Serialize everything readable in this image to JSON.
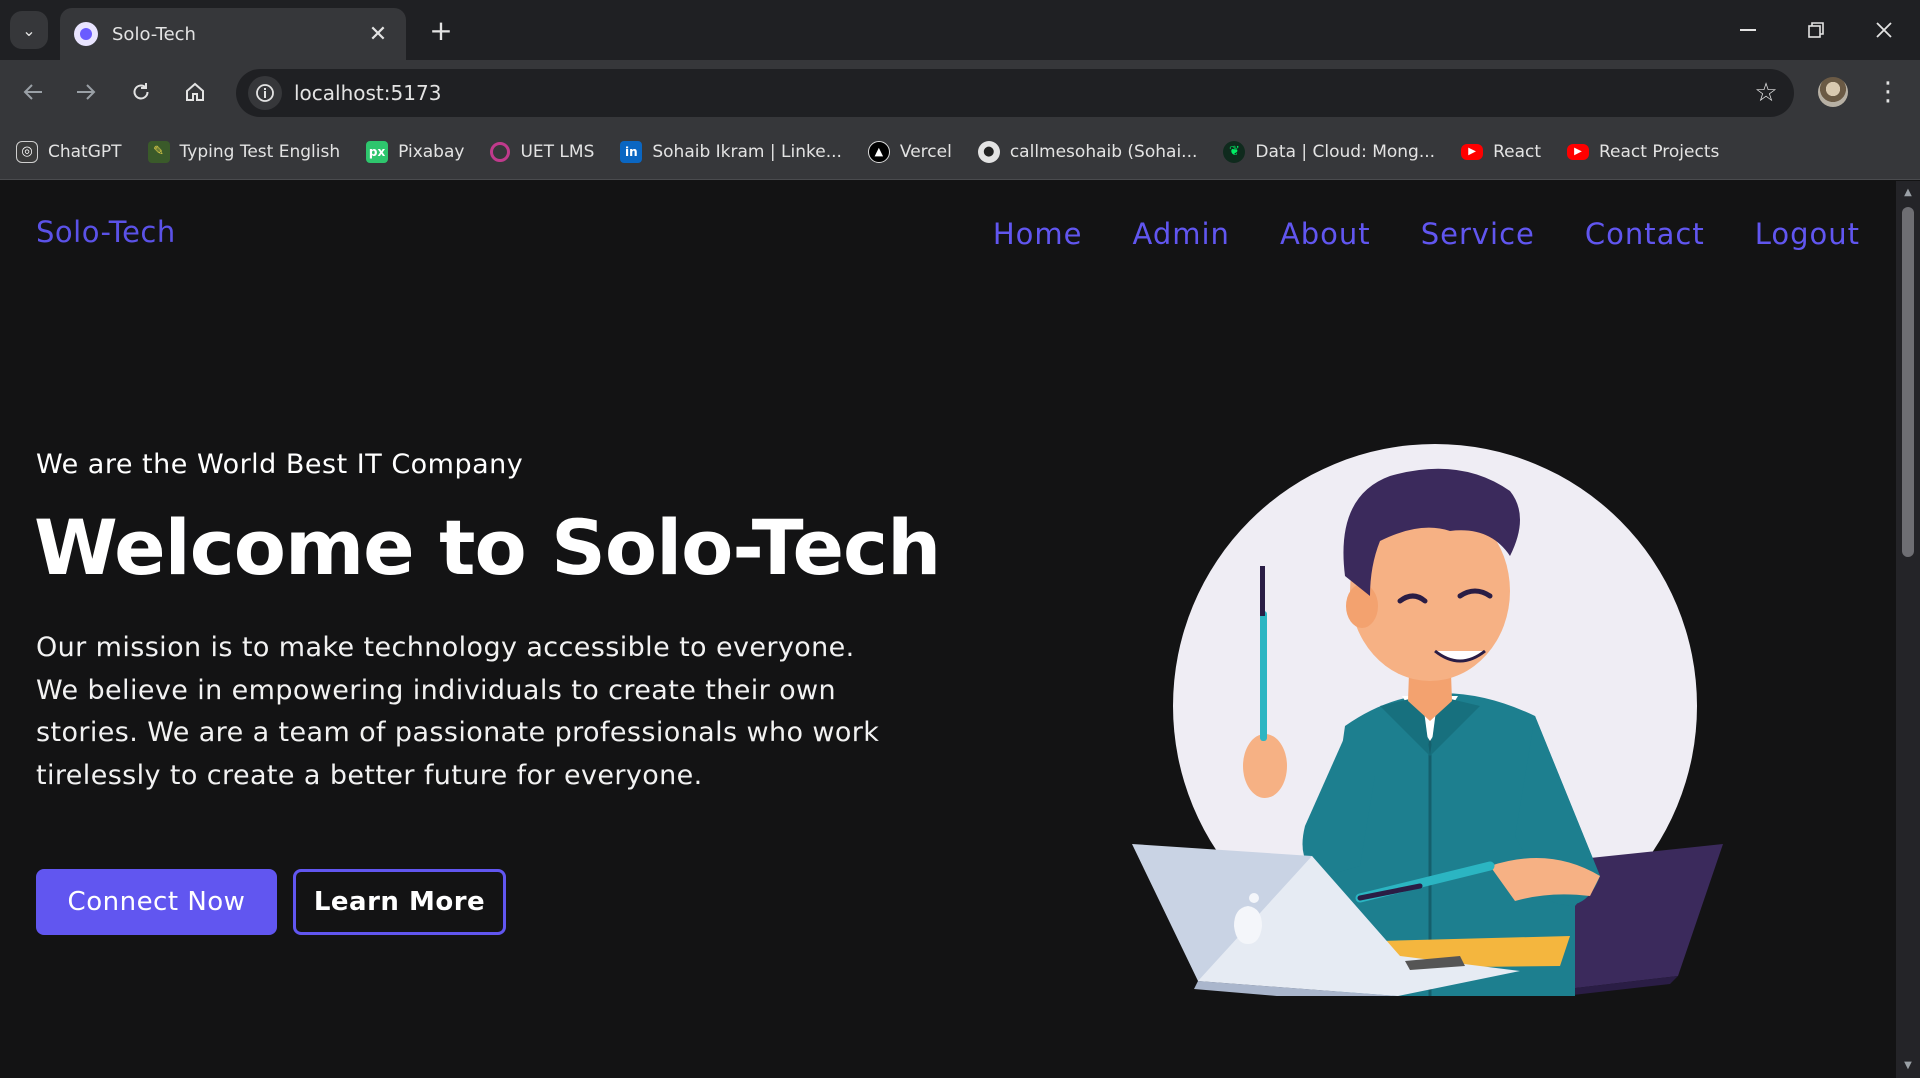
{
  "browser": {
    "tab_title": "Solo-Tech",
    "tab_close": "✕",
    "new_tab": "+",
    "url": "localhost:5173",
    "bookmarks": [
      {
        "label": "ChatGPT",
        "icon": "chatgpt-icon"
      },
      {
        "label": "Typing Test English",
        "icon": "typing-test-icon"
      },
      {
        "label": "Pixabay",
        "icon": "pixabay-icon"
      },
      {
        "label": "UET LMS",
        "icon": "uet-lms-icon"
      },
      {
        "label": "Sohaib Ikram | Linke...",
        "icon": "linkedin-icon"
      },
      {
        "label": "Vercel",
        "icon": "vercel-icon"
      },
      {
        "label": "callmesohaib (Sohai...",
        "icon": "github-icon"
      },
      {
        "label": "Data | Cloud: Mong...",
        "icon": "mongodb-icon"
      },
      {
        "label": "React",
        "icon": "youtube-icon"
      },
      {
        "label": "React Projects",
        "icon": "youtube-icon"
      }
    ]
  },
  "page": {
    "brand": "Solo-Tech",
    "nav": [
      "Home",
      "Admin",
      "About",
      "Service",
      "Contact",
      "Logout"
    ],
    "hero": {
      "tagline": "We are the World Best IT Company",
      "title": "Welcome to Solo-Tech",
      "mission": "Our mission is to make technology accessible to everyone. We believe in empowering individuals to create their own stories. We are a team of passionate professionals who work tirelessly to create a better future for everyone.",
      "primary_button": "Connect Now",
      "secondary_button": "Learn More"
    }
  },
  "colors": {
    "accent": "#6156f0",
    "brand": "#5b52e8",
    "page_background": "#131314",
    "chrome_background": "#1f2023",
    "toolbar_background": "#36373a"
  }
}
